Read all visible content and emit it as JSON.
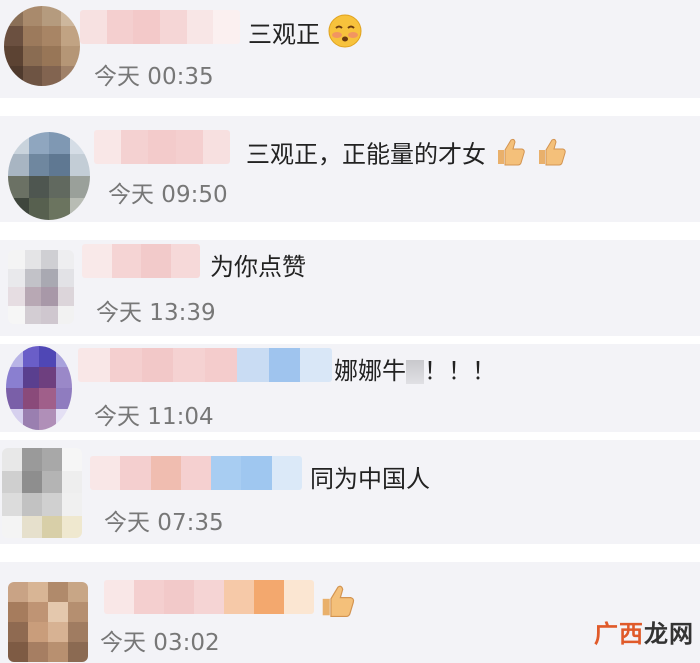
{
  "comments": [
    {
      "text": "三观正",
      "time": "今天 00:35"
    },
    {
      "text": "三观正，正能量的才女",
      "time": "今天 09:50"
    },
    {
      "text": "为你点赞",
      "time": "今天 13:39"
    },
    {
      "text": "娜娜牛",
      "text_suffix": "！！！",
      "time": "今天 11:04"
    },
    {
      "text": "同为中国人",
      "time": "今天 07:35"
    },
    {
      "text": "",
      "time": "今天 03:02"
    }
  ],
  "icons": {
    "comment_1": "flushed-face-emoji",
    "comment_2": "thumbs-up-emoji",
    "comment_6": "thumbs-up-emoji"
  },
  "watermark": {
    "left": "广西",
    "right": "龙网"
  },
  "colors": {
    "card_bg": "#f3f3f7",
    "time": "#777777",
    "watermark": "#e05a2a"
  }
}
